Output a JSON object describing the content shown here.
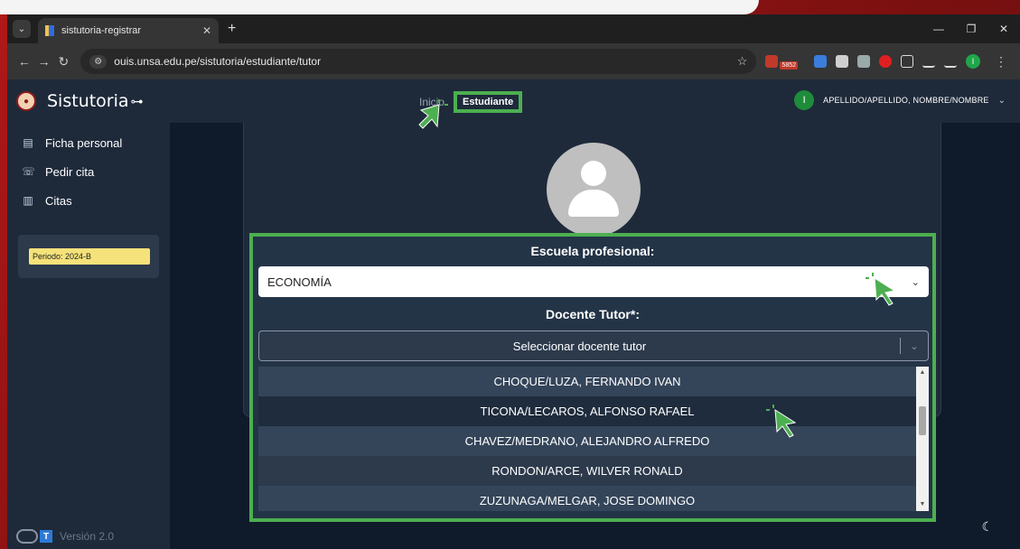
{
  "browser": {
    "tab_title": "sistutoria-registrar",
    "url": "ouis.unsa.edu.pe/sistutoria/estudiante/tutor",
    "ext_badge": "5852",
    "profile_initial": "I"
  },
  "header": {
    "brand": "Sistutoria",
    "nav_inicio": "Inicio",
    "nav_estudiante": "Estudiante",
    "user_initial": "I",
    "user_name": "APELLIDO/APELLIDO, NOMBRE/NOMBRE"
  },
  "sidebar": {
    "items": [
      {
        "label": "Ficha personal",
        "icon": "id-card-icon"
      },
      {
        "label": "Pedir cita",
        "icon": "phone-icon"
      },
      {
        "label": "Citas",
        "icon": "book-icon"
      }
    ],
    "period": "Periodo: 2024-B",
    "version": "Versión 2.0"
  },
  "form": {
    "escuela_label": "Escuela profesional:",
    "escuela_value": "ECONOMÍA",
    "docente_label": "Docente Tutor*:",
    "docente_placeholder": "Seleccionar docente tutor",
    "options": [
      "CHOQUE/LUZA, FERNANDO IVAN",
      "TICONA/LECAROS, ALFONSO RAFAEL",
      "CHAVEZ/MEDRANO, ALEJANDRO ALFREDO",
      "RONDON/ARCE, WILVER RONALD",
      "ZUZUNAGA/MELGAR, JOSE DOMINGO"
    ]
  },
  "colors": {
    "accent_green": "#4caf50",
    "period_yellow": "#f5e27a",
    "panel_dark": "#1e2a3a"
  }
}
